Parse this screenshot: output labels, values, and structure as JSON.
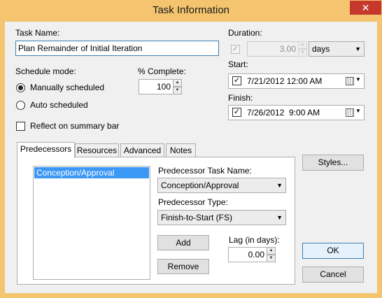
{
  "window": {
    "title": "Task Information",
    "close_glyph": "✕"
  },
  "task_name": {
    "label": "Task Name:",
    "value": "Plan Remainder of Initial Iteration"
  },
  "duration": {
    "label": "Duration:",
    "value": "3.00",
    "unit": "days",
    "estimated_checked": true
  },
  "schedule_mode": {
    "label": "Schedule mode:",
    "options": [
      "Manually scheduled",
      "Auto scheduled"
    ],
    "selected": "Manually scheduled"
  },
  "percent_complete": {
    "label": "% Complete:",
    "value": "100"
  },
  "start": {
    "label": "Start:",
    "checked": true,
    "value": "7/21/2012 12:00 AM"
  },
  "finish": {
    "label": "Finish:",
    "checked": true,
    "value": "7/26/2012  9:00 AM"
  },
  "reflect": {
    "label": "Reflect on summary bar",
    "checked": false
  },
  "tabs": [
    "Predecessors",
    "Resources",
    "Advanced",
    "Notes"
  ],
  "active_tab": "Predecessors",
  "predecessors": {
    "list": [
      "Conception/Approval"
    ],
    "selected": "Conception/Approval",
    "task_name_label": "Predecessor Task Name:",
    "task_name_value": "Conception/Approval",
    "type_label": "Predecessor Type:",
    "type_value": "Finish-to-Start (FS)",
    "add_label": "Add",
    "remove_label": "Remove",
    "lag_label": "Lag (in days):",
    "lag_value": "0.00"
  },
  "buttons": {
    "styles": "Styles...",
    "ok": "OK",
    "cancel": "Cancel"
  },
  "glyphs": {
    "check": "✓",
    "up": "▲",
    "down": "▼"
  },
  "colors": {
    "titlebar": "#f4c56e",
    "close": "#c7382c",
    "selection": "#3b98f5"
  }
}
